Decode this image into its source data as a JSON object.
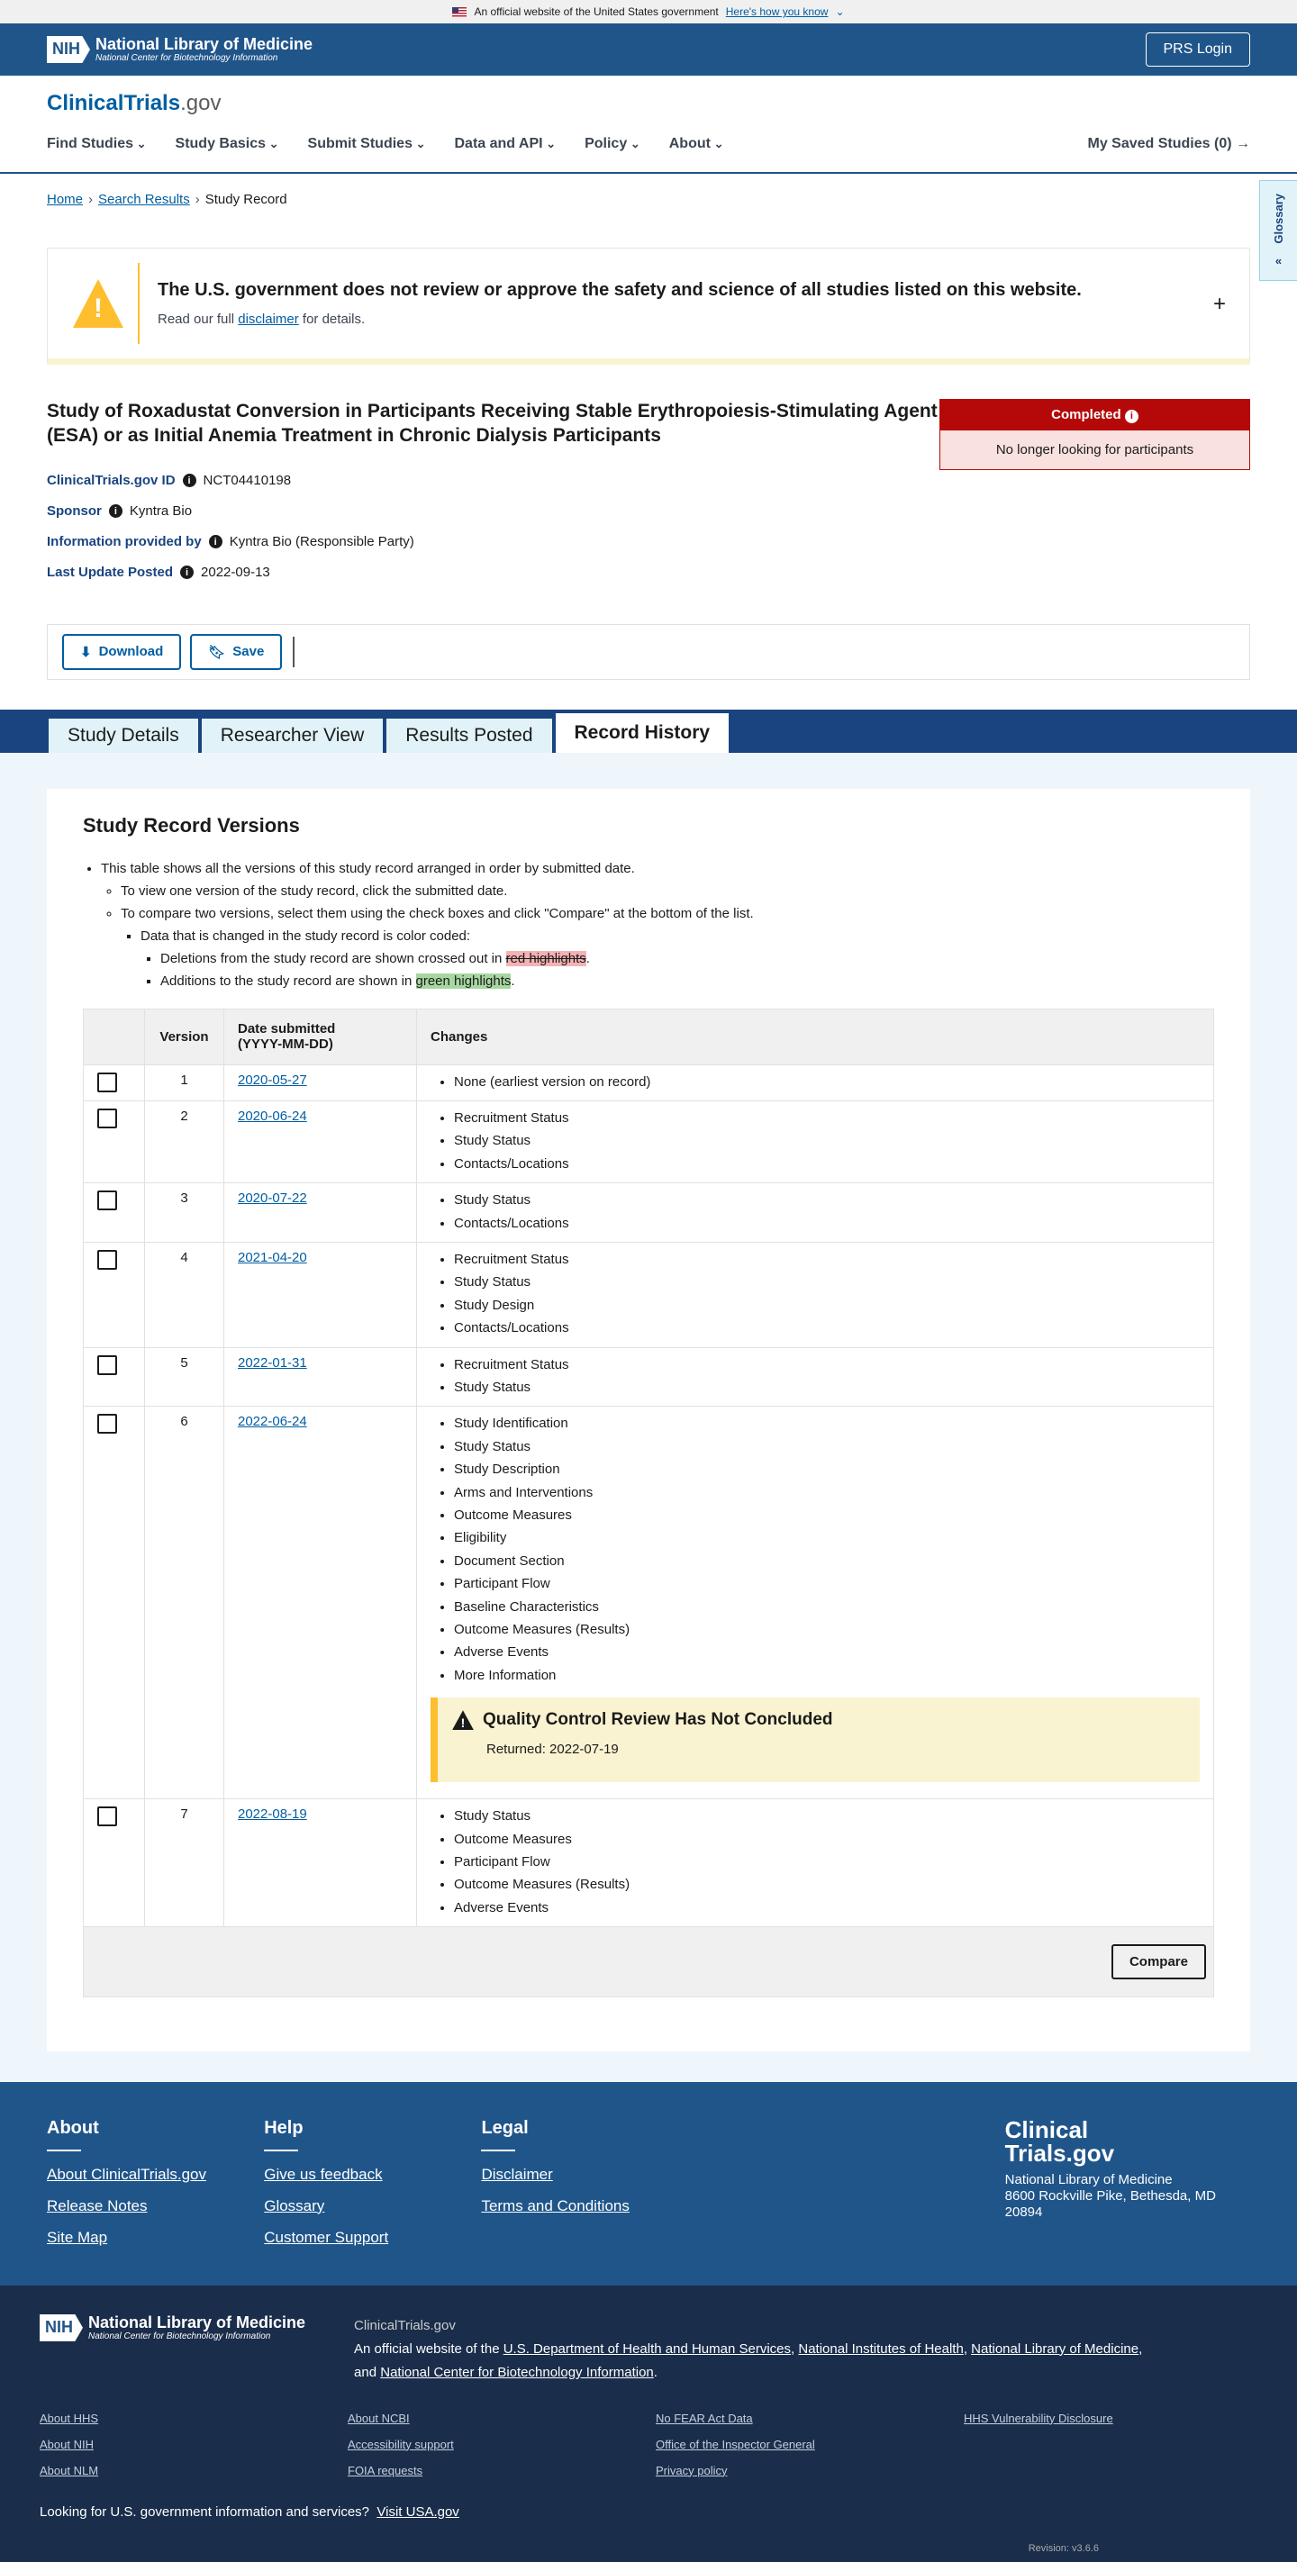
{
  "gov_banner": {
    "text": "An official website of the United States government",
    "link": "Here's how you know"
  },
  "nlm": {
    "nih": "NIH",
    "name": "National Library of Medicine",
    "sub": "National Center for Biotechnology Information",
    "prs": "PRS Login"
  },
  "site": {
    "logo_a": "ClinicalTrials",
    "logo_b": ".gov"
  },
  "nav": {
    "items": [
      "Find Studies",
      "Study Basics",
      "Submit Studies",
      "Data and API",
      "Policy",
      "About"
    ],
    "saved": "My Saved Studies (0) →"
  },
  "breadcrumb": {
    "home": "Home",
    "search": "Search Results",
    "current": "Study Record"
  },
  "glossary": "Glossary",
  "disclaimer": {
    "title": "The U.S. government does not review or approve the safety and science of all studies listed on this website.",
    "pre": "Read our full",
    "link": "disclaimer",
    "post": "for details."
  },
  "study": {
    "title": "Study of Roxadustat Conversion in Participants Receiving Stable Erythropoiesis-Stimulating Agent (ESA) or as Initial Anemia Treatment in Chronic Dialysis Participants",
    "status": "Completed",
    "status_detail": "No longer looking for participants",
    "meta": [
      {
        "label": "ClinicalTrials.gov ID",
        "value": "NCT04410198"
      },
      {
        "label": "Sponsor",
        "value": "Kyntra Bio"
      },
      {
        "label": "Information provided by",
        "value": "Kyntra Bio (Responsible Party)"
      },
      {
        "label": "Last Update Posted",
        "value": "2022-09-13"
      }
    ]
  },
  "actions": {
    "download": "Download",
    "save": "Save"
  },
  "tabs": [
    "Study Details",
    "Researcher View",
    "Results Posted",
    "Record History"
  ],
  "versions": {
    "heading": "Study Record Versions",
    "note1": "This table shows all the versions of this study record arranged in order by submitted date.",
    "note2": "To view one version of the study record, click the submitted date.",
    "note3": "To compare two versions, select them using the check boxes and click \"Compare\" at the bottom of the list.",
    "note4": "Data that is changed in the study record is color coded:",
    "note5_pre": "Deletions from the study record are shown crossed out in",
    "note5_hl": "red highlights",
    "note5_post": ".",
    "note6_pre": "Additions to the study record are shown in",
    "note6_hl": "green highlights",
    "note6_post": ".",
    "col_version": "Version",
    "col_date": "Date submitted",
    "col_date2": "(YYYY-MM-DD)",
    "col_changes": "Changes",
    "qc_title": "Quality Control Review Has Not Concluded",
    "qc_sub": "Returned: 2022-07-19",
    "compare": "Compare",
    "rows": [
      {
        "v": "1",
        "date": "2020-05-27",
        "changes": [
          "None (earliest version on record)"
        ]
      },
      {
        "v": "2",
        "date": "2020-06-24",
        "changes": [
          "Recruitment Status",
          "Study Status",
          "Contacts/Locations"
        ]
      },
      {
        "v": "3",
        "date": "2020-07-22",
        "changes": [
          "Study Status",
          "Contacts/Locations"
        ]
      },
      {
        "v": "4",
        "date": "2021-04-20",
        "changes": [
          "Recruitment Status",
          "Study Status",
          "Study Design",
          "Contacts/Locations"
        ]
      },
      {
        "v": "5",
        "date": "2022-01-31",
        "changes": [
          "Recruitment Status",
          "Study Status"
        ]
      },
      {
        "v": "6",
        "date": "2022-06-24",
        "changes": [
          "Study Identification",
          "Study Status",
          "Study Description",
          "Arms and Interventions",
          "Outcome Measures",
          "Eligibility",
          "Document Section",
          "Participant Flow",
          "Baseline Characteristics",
          "Outcome Measures (Results)",
          "Adverse Events",
          "More Information"
        ],
        "qc": true
      },
      {
        "v": "7",
        "date": "2022-08-19",
        "changes": [
          "Study Status",
          "Outcome Measures",
          "Participant Flow",
          "Outcome Measures (Results)",
          "Adverse Events"
        ]
      }
    ]
  },
  "footer": {
    "about_h": "About",
    "about": [
      "About ClinicalTrials.gov",
      "Release Notes",
      "Site Map"
    ],
    "help_h": "Help",
    "help": [
      "Give us feedback",
      "Glossary",
      "Customer Support"
    ],
    "legal_h": "Legal",
    "legal": [
      "Disclaimer",
      "Terms and Conditions"
    ],
    "logo1": "Clinical",
    "logo2": "Trials.gov",
    "addr1": "National Library of Medicine",
    "addr2": "8600 Rockville Pike, Bethesda, MD",
    "addr3": "20894"
  },
  "footer2": {
    "site": "ClinicalTrials.gov",
    "official_pre": "An official website of the",
    "hhs": "U.S. Department of Health and Human Services",
    "nih": "National Institutes of Health",
    "nlm": "National Library of Medicine",
    "and": "and",
    "ncbi": "National Center for Biotechnology Information",
    "links": [
      "About HHS",
      "About NCBI",
      "No FEAR Act Data",
      "HHS Vulnerability Disclosure",
      "About NIH",
      "Accessibility support",
      "Office of the Inspector General",
      "",
      "About NLM",
      "FOIA requests",
      "Privacy policy",
      ""
    ],
    "usa_pre": "Looking for U.S. government information and services?",
    "usa_link": "Visit USA.gov",
    "revision": "Revision: v3.6.6"
  }
}
